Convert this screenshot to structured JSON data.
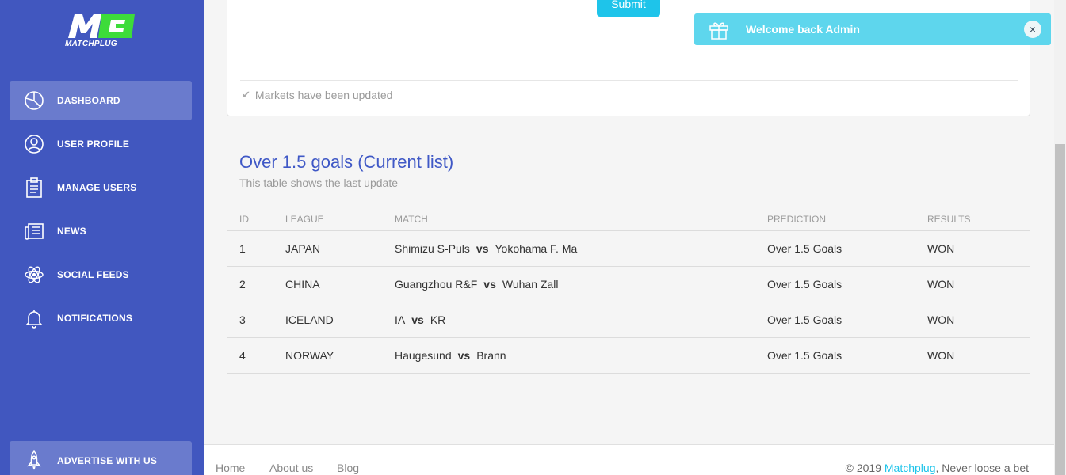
{
  "brand": {
    "logo_text": "MATCHPLUG"
  },
  "sidebar": {
    "items": [
      {
        "label": "DASHBOARD",
        "icon": "pie-chart-icon",
        "active": true
      },
      {
        "label": "USER PROFILE",
        "icon": "user-icon"
      },
      {
        "label": "MANAGE USERS",
        "icon": "clipboard-icon"
      },
      {
        "label": "NEWS",
        "icon": "newspaper-icon"
      },
      {
        "label": "SOCIAL FEEDS",
        "icon": "atom-icon"
      },
      {
        "label": "NOTIFICATIONS",
        "icon": "bell-icon"
      }
    ],
    "advertise": {
      "label": "ADVERTISE WITH US",
      "icon": "rocket-icon"
    }
  },
  "card": {
    "submit_label": "Submit",
    "status": "Markets have been updated"
  },
  "table": {
    "title": "Over 1.5 goals (Current list)",
    "subtitle": "This table shows the last update",
    "headers": [
      "ID",
      "LEAGUE",
      "MATCH",
      "PREDICTION",
      "RESULTS"
    ],
    "vs_label": "vs",
    "rows": [
      {
        "id": "1",
        "league": "JAPAN",
        "home": "Shimizu S-Puls",
        "away": "Yokohama F. Ma",
        "prediction": "Over 1.5 Goals",
        "result": "WON"
      },
      {
        "id": "2",
        "league": "CHINA",
        "home": "Guangzhou R&F",
        "away": "Wuhan Zall",
        "prediction": "Over 1.5 Goals",
        "result": "WON"
      },
      {
        "id": "3",
        "league": "ICELAND",
        "home": "IA",
        "away": "KR",
        "prediction": "Over 1.5 Goals",
        "result": "WON"
      },
      {
        "id": "4",
        "league": "NORWAY",
        "home": "Haugesund",
        "away": "Brann",
        "prediction": "Over 1.5 Goals",
        "result": "WON"
      }
    ]
  },
  "footer": {
    "links": [
      "Home",
      "About us",
      "Blog"
    ],
    "copyright_prefix": "© 2019",
    "copyright_brand": "Matchplug",
    "copyright_suffix": ", Never loose a bet"
  },
  "toast": {
    "text": "Welcome back",
    "user": "Admin",
    "close": "×"
  },
  "colors": {
    "sidebar": "#4157bf",
    "accent": "#1ec4ea",
    "title": "#3f58c6",
    "toast": "#5ed6ed",
    "logo_green": "#3ddc3a"
  }
}
